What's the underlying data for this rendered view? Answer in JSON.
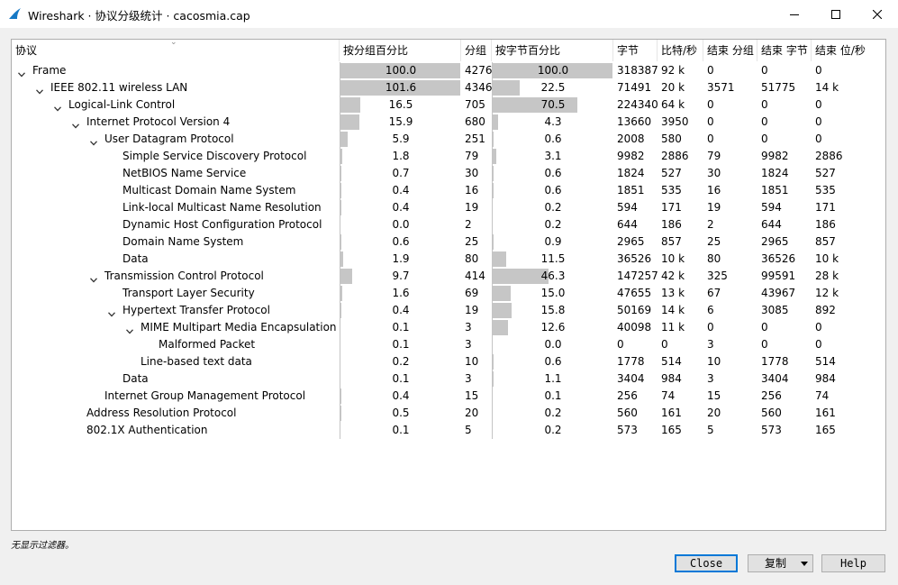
{
  "window": {
    "title": "Wireshark · 协议分级统计 · cacosmia.cap"
  },
  "columns": [
    {
      "label": "协议"
    },
    {
      "label": "按分组百分比"
    },
    {
      "label": "分组"
    },
    {
      "label": "按字节百分比"
    },
    {
      "label": "字节"
    },
    {
      "label": "比特/秒"
    },
    {
      "label": "结束 分组"
    },
    {
      "label": "结束 字节"
    },
    {
      "label": "结束 位/秒"
    }
  ],
  "rows": [
    {
      "name": "Frame",
      "depth": 0,
      "expander": "expanded",
      "pct_packets": "100.0",
      "packets": "4276",
      "pct_bytes": "100.0",
      "bytes": "318387",
      "bps": "92 k",
      "end_packets": "0",
      "end_bytes": "0",
      "end_bps": "0"
    },
    {
      "name": "IEEE 802.11 wireless LAN",
      "depth": 1,
      "expander": "expanded",
      "pct_packets": "101.6",
      "packets": "4346",
      "pct_bytes": "22.5",
      "bytes": "71491",
      "bps": "20 k",
      "end_packets": "3571",
      "end_bytes": "51775",
      "end_bps": "14 k"
    },
    {
      "name": "Logical-Link Control",
      "depth": 2,
      "expander": "expanded",
      "pct_packets": "16.5",
      "packets": "705",
      "pct_bytes": "70.5",
      "bytes": "224340",
      "bps": "64 k",
      "end_packets": "0",
      "end_bytes": "0",
      "end_bps": "0"
    },
    {
      "name": "Internet Protocol Version 4",
      "depth": 3,
      "expander": "expanded",
      "pct_packets": "15.9",
      "packets": "680",
      "pct_bytes": "4.3",
      "bytes": "13660",
      "bps": "3950",
      "end_packets": "0",
      "end_bytes": "0",
      "end_bps": "0"
    },
    {
      "name": "User Datagram Protocol",
      "depth": 4,
      "expander": "expanded",
      "pct_packets": "5.9",
      "packets": "251",
      "pct_bytes": "0.6",
      "bytes": "2008",
      "bps": "580",
      "end_packets": "0",
      "end_bytes": "0",
      "end_bps": "0"
    },
    {
      "name": "Simple Service Discovery Protocol",
      "depth": 5,
      "expander": "none",
      "pct_packets": "1.8",
      "packets": "79",
      "pct_bytes": "3.1",
      "bytes": "9982",
      "bps": "2886",
      "end_packets": "79",
      "end_bytes": "9982",
      "end_bps": "2886"
    },
    {
      "name": "NetBIOS Name Service",
      "depth": 5,
      "expander": "none",
      "pct_packets": "0.7",
      "packets": "30",
      "pct_bytes": "0.6",
      "bytes": "1824",
      "bps": "527",
      "end_packets": "30",
      "end_bytes": "1824",
      "end_bps": "527"
    },
    {
      "name": "Multicast Domain Name System",
      "depth": 5,
      "expander": "none",
      "pct_packets": "0.4",
      "packets": "16",
      "pct_bytes": "0.6",
      "bytes": "1851",
      "bps": "535",
      "end_packets": "16",
      "end_bytes": "1851",
      "end_bps": "535"
    },
    {
      "name": "Link-local Multicast Name Resolution",
      "depth": 5,
      "expander": "none",
      "pct_packets": "0.4",
      "packets": "19",
      "pct_bytes": "0.2",
      "bytes": "594",
      "bps": "171",
      "end_packets": "19",
      "end_bytes": "594",
      "end_bps": "171"
    },
    {
      "name": "Dynamic Host Configuration Protocol",
      "depth": 5,
      "expander": "none",
      "pct_packets": "0.0",
      "packets": "2",
      "pct_bytes": "0.2",
      "bytes": "644",
      "bps": "186",
      "end_packets": "2",
      "end_bytes": "644",
      "end_bps": "186"
    },
    {
      "name": "Domain Name System",
      "depth": 5,
      "expander": "none",
      "pct_packets": "0.6",
      "packets": "25",
      "pct_bytes": "0.9",
      "bytes": "2965",
      "bps": "857",
      "end_packets": "25",
      "end_bytes": "2965",
      "end_bps": "857"
    },
    {
      "name": "Data",
      "depth": 5,
      "expander": "none",
      "pct_packets": "1.9",
      "packets": "80",
      "pct_bytes": "11.5",
      "bytes": "36526",
      "bps": "10 k",
      "end_packets": "80",
      "end_bytes": "36526",
      "end_bps": "10 k"
    },
    {
      "name": "Transmission Control Protocol",
      "depth": 4,
      "expander": "expanded",
      "pct_packets": "9.7",
      "packets": "414",
      "pct_bytes": "46.3",
      "bytes": "147257",
      "bps": "42 k",
      "end_packets": "325",
      "end_bytes": "99591",
      "end_bps": "28 k"
    },
    {
      "name": "Transport Layer Security",
      "depth": 5,
      "expander": "none",
      "pct_packets": "1.6",
      "packets": "69",
      "pct_bytes": "15.0",
      "bytes": "47655",
      "bps": "13 k",
      "end_packets": "67",
      "end_bytes": "43967",
      "end_bps": "12 k"
    },
    {
      "name": "Hypertext Transfer Protocol",
      "depth": 5,
      "expander": "expanded",
      "pct_packets": "0.4",
      "packets": "19",
      "pct_bytes": "15.8",
      "bytes": "50169",
      "bps": "14 k",
      "end_packets": "6",
      "end_bytes": "3085",
      "end_bps": "892"
    },
    {
      "name": "MIME Multipart Media Encapsulation",
      "depth": 6,
      "expander": "expanded",
      "pct_packets": "0.1",
      "packets": "3",
      "pct_bytes": "12.6",
      "bytes": "40098",
      "bps": "11 k",
      "end_packets": "0",
      "end_bytes": "0",
      "end_bps": "0"
    },
    {
      "name": "Malformed Packet",
      "depth": 7,
      "expander": "none",
      "pct_packets": "0.1",
      "packets": "3",
      "pct_bytes": "0.0",
      "bytes": "0",
      "bps": "0",
      "end_packets": "3",
      "end_bytes": "0",
      "end_bps": "0"
    },
    {
      "name": "Line-based text data",
      "depth": 6,
      "expander": "none",
      "pct_packets": "0.2",
      "packets": "10",
      "pct_bytes": "0.6",
      "bytes": "1778",
      "bps": "514",
      "end_packets": "10",
      "end_bytes": "1778",
      "end_bps": "514"
    },
    {
      "name": "Data",
      "depth": 5,
      "expander": "none",
      "pct_packets": "0.1",
      "packets": "3",
      "pct_bytes": "1.1",
      "bytes": "3404",
      "bps": "984",
      "end_packets": "3",
      "end_bytes": "3404",
      "end_bps": "984"
    },
    {
      "name": "Internet Group Management Protocol",
      "depth": 4,
      "expander": "none",
      "pct_packets": "0.4",
      "packets": "15",
      "pct_bytes": "0.1",
      "bytes": "256",
      "bps": "74",
      "end_packets": "15",
      "end_bytes": "256",
      "end_bps": "74"
    },
    {
      "name": "Address Resolution Protocol",
      "depth": 3,
      "expander": "none",
      "pct_packets": "0.5",
      "packets": "20",
      "pct_bytes": "0.2",
      "bytes": "560",
      "bps": "161",
      "end_packets": "20",
      "end_bytes": "560",
      "end_bps": "161"
    },
    {
      "name": "802.1X Authentication",
      "depth": 3,
      "expander": "none",
      "pct_packets": "0.1",
      "packets": "5",
      "pct_bytes": "0.2",
      "bytes": "573",
      "bps": "165",
      "end_packets": "5",
      "end_bytes": "573",
      "end_bps": "165"
    }
  ],
  "status": {
    "text": "无显示过滤器。"
  },
  "buttons": {
    "close": "Close",
    "copy": "复制",
    "help": "Help"
  },
  "colors": {
    "bar_fill": "#c6c6c6",
    "focus": "#0078d7",
    "app_icon": "#1679c5"
  }
}
